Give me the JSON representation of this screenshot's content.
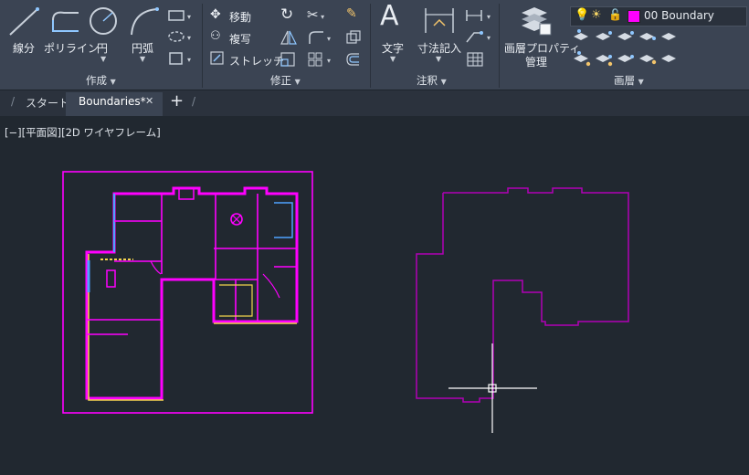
{
  "ribbon": {
    "draw_group": {
      "label": "作成",
      "line_label": "線分",
      "polyline_label": "ポリライン",
      "circle_label": "円",
      "arc_label": "円弧"
    },
    "modify_group": {
      "label": "修正",
      "move_label": "移動",
      "copy_label": "複写",
      "stretch_label": "ストレッチ"
    },
    "annotation_group": {
      "label": "注釈",
      "text_label": "文字",
      "text_glyph": "A",
      "dimension_label": "寸法記入"
    },
    "layers_group": {
      "label": "画層",
      "properties_label_line1": "画層プロパティ",
      "properties_label_line2": "管理",
      "current_layer": "00 Boundary",
      "current_layer_color": "#ff00ff"
    }
  },
  "tabs": {
    "start_label": "スタート",
    "active_label": "Boundaries*",
    "close_glyph": "✕",
    "add_glyph": "+"
  },
  "viewport": {
    "label": "[−][平面図][2D ワイヤフレーム]"
  },
  "colors": {
    "ribbon_bg": "#3b4453",
    "canvas_bg": "#212830",
    "magenta": "#ff00ff",
    "plan_line": "#b100b6"
  }
}
